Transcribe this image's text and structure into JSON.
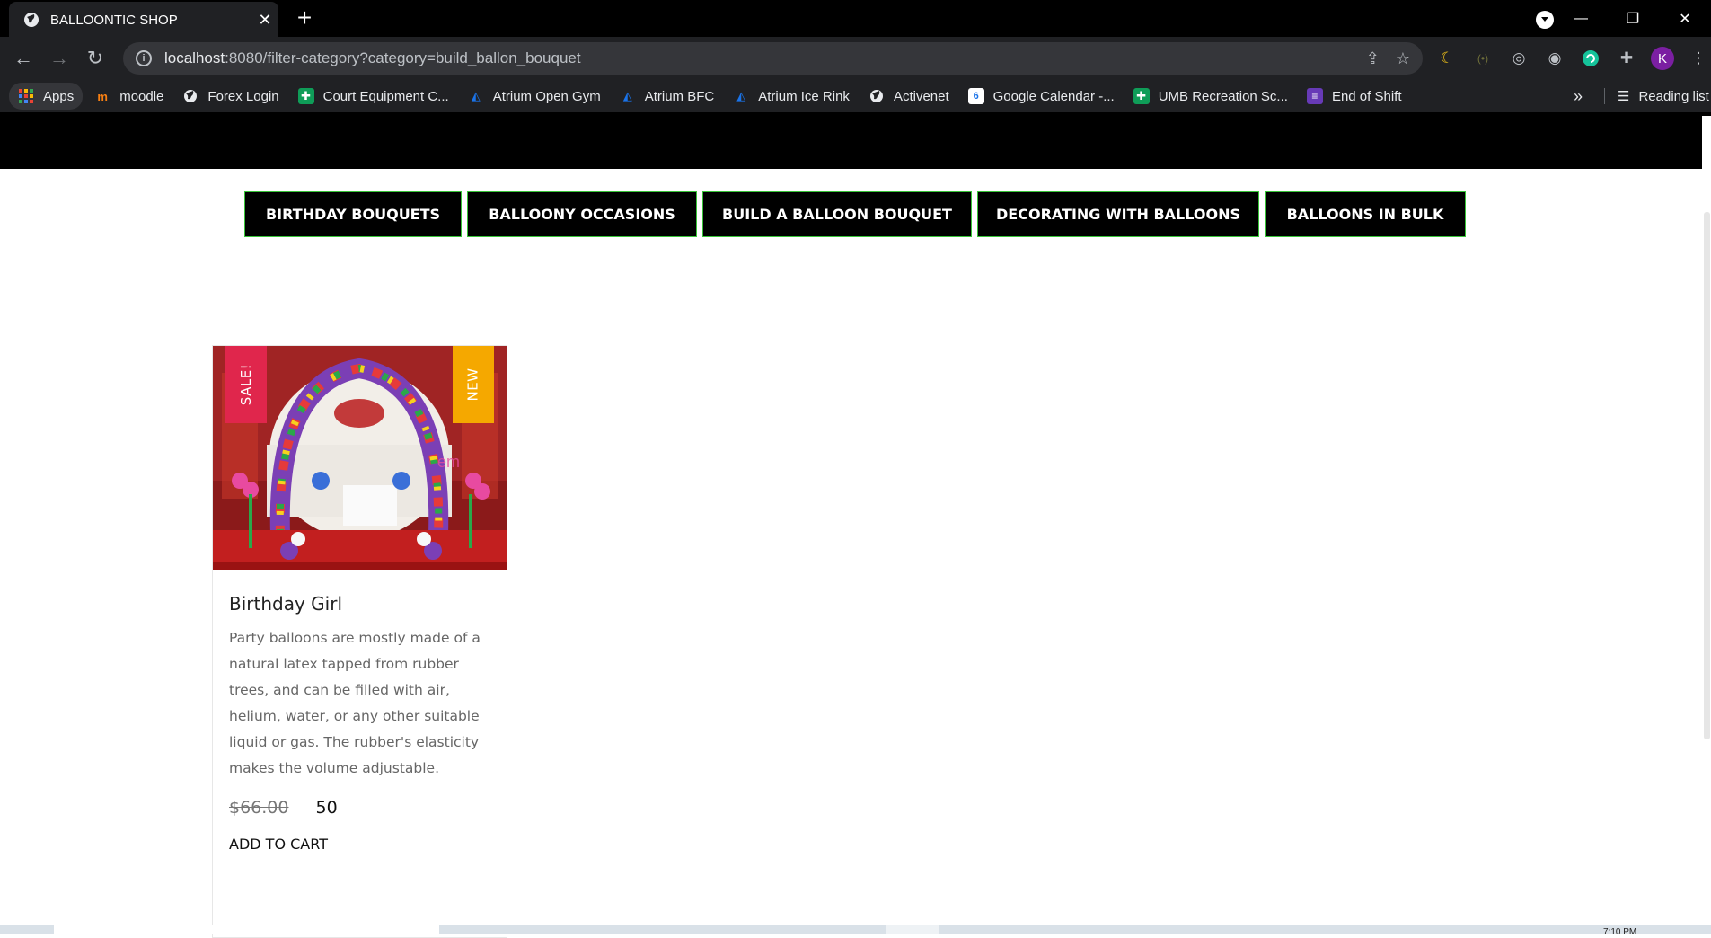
{
  "browser": {
    "tab_title": "BALLOONTIC SHOP",
    "url_host": "localhost",
    "url_rest": ":8080/filter-category?category=build_ballon_bouquet",
    "avatar_letter": "K",
    "bookmarks": [
      {
        "label": "Apps",
        "icon": "apps-grid-icon"
      },
      {
        "label": "moodle",
        "icon": "moodle-icon"
      },
      {
        "label": "Forex Login",
        "icon": "globe-icon"
      },
      {
        "label": "Court Equipment C...",
        "icon": "sheets-icon"
      },
      {
        "label": "Atrium Open Gym",
        "icon": "atrium-icon"
      },
      {
        "label": "Atrium BFC",
        "icon": "atrium-icon"
      },
      {
        "label": "Atrium Ice Rink",
        "icon": "atrium-icon"
      },
      {
        "label": "Activenet",
        "icon": "globe-icon"
      },
      {
        "label": "Google Calendar -...",
        "icon": "calendar-icon"
      },
      {
        "label": "UMB Recreation Sc...",
        "icon": "sheets-icon"
      },
      {
        "label": "End of Shift",
        "icon": "forms-icon"
      }
    ],
    "more_bookmarks": "»",
    "reading_list": "Reading list"
  },
  "site": {
    "categories": [
      {
        "label": "BIRTHDAY BOUQUETS"
      },
      {
        "label": "BALLOONY OCCASIONS"
      },
      {
        "label": "BUILD A BALLOON BOUQUET"
      },
      {
        "label": "DECORATING WITH BALLOONS"
      },
      {
        "label": "BALLOONS IN BULK"
      }
    ],
    "product": {
      "badge_sale": "SALE!",
      "badge_new": "NEW",
      "title": "Birthday Girl",
      "description": "Party balloons are mostly made of a natural latex tapped from rubber trees, and can be filled with air, helium, water, or any other suitable liquid or gas. The rubber's elasticity makes the volume adjustable.",
      "old_price": "$66.00",
      "price": "50",
      "add_to_cart": "ADD TO CART"
    }
  },
  "taskbar": {
    "clock": "7:10 PM"
  },
  "colors": {
    "category_border": "#38c438",
    "sale_badge": "#e0264c",
    "new_badge": "#f5a800"
  }
}
